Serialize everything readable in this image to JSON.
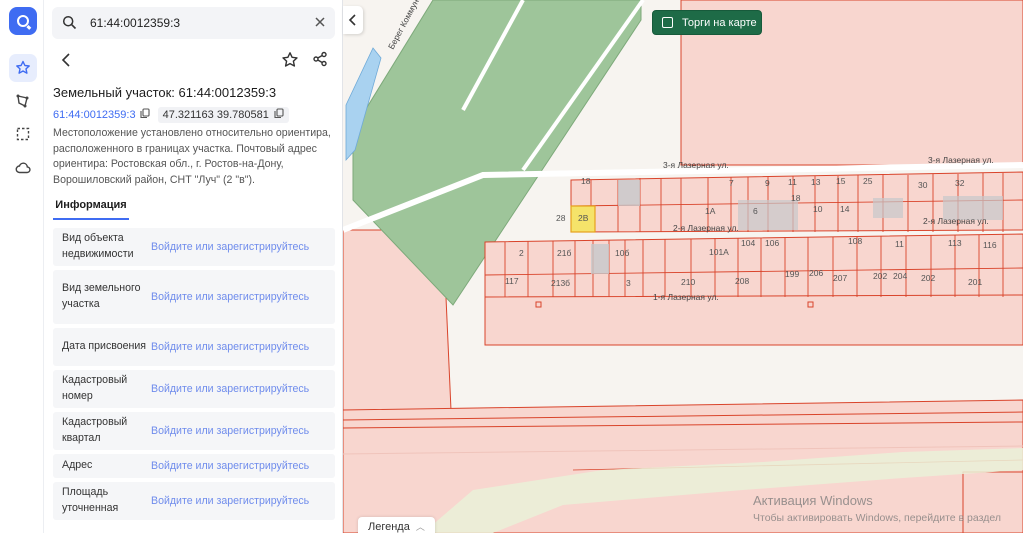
{
  "search": {
    "value": "61:44:0012359:3"
  },
  "parcel": {
    "title": "Земельный участок: 61:44:0012359:3",
    "cadastral": "61:44:0012359:3",
    "coords": "47.321163 39.780581",
    "description": "Местоположение установлено относительно ориентира, расположенного в границах участка. Почтовый адрес ориентира: Ростовская обл., г. Ростов-на-Дону, Ворошиловский район, СНТ \"Луч\" (2 \"в\")."
  },
  "tabs": {
    "info": "Информация"
  },
  "rows": [
    {
      "label": "Вид объекта недвижимости",
      "value": "Войдите или зарегистрируйтесь"
    },
    {
      "label": "Вид земельного участка",
      "value": "Войдите или зарегистрируйтесь"
    },
    {
      "label": "Дата присвоения",
      "value": "Войдите или зарегистрируйтесь"
    },
    {
      "label": "Кадастровый номер",
      "value": "Войдите или зарегистрируйтесь"
    },
    {
      "label": "Кадастровый квартал",
      "value": "Войдите или зарегистрируйтесь"
    },
    {
      "label": "Адрес",
      "value": "Войдите или зарегистрируйтесь"
    },
    {
      "label": "Площадь уточненная",
      "value": "Войдите или зарегистрируйтесь"
    }
  ],
  "map": {
    "torgi_label": "Торги на карте",
    "legend_label": "Легенда",
    "streets": {
      "s3a": "3-я Лазерная ул.",
      "s3b": "3-я Лазерная ул.",
      "s2a": "2-я Лазерная ул.",
      "s2b": "2-я Лазерная ул.",
      "s1": "1-я Лазерная ул.",
      "kom": "Берег Коммуна"
    },
    "parcels": [
      "18",
      "28",
      "2В",
      "7",
      "9",
      "11",
      "13",
      "15",
      "25",
      "30",
      "32",
      "1А",
      "6",
      "10",
      "14",
      "18",
      "2",
      "21б",
      "10б",
      "101А",
      "104",
      "106",
      "108",
      "11",
      "113",
      "116",
      "117",
      "213б",
      "3",
      "210",
      "208",
      "207",
      "204",
      "202",
      "201",
      "199",
      "206",
      "202",
      "21"
    ],
    "watermark_title": "Активация Windows",
    "watermark_text": "Чтобы активировать Windows, перейдите в раздел"
  },
  "colors": {
    "accent": "#3f6cf2",
    "torgi": "#1e6b47",
    "parcel_stroke": "#d9442b",
    "parcel_fill": "#f8d3cb",
    "selected": "#f5e36a"
  }
}
